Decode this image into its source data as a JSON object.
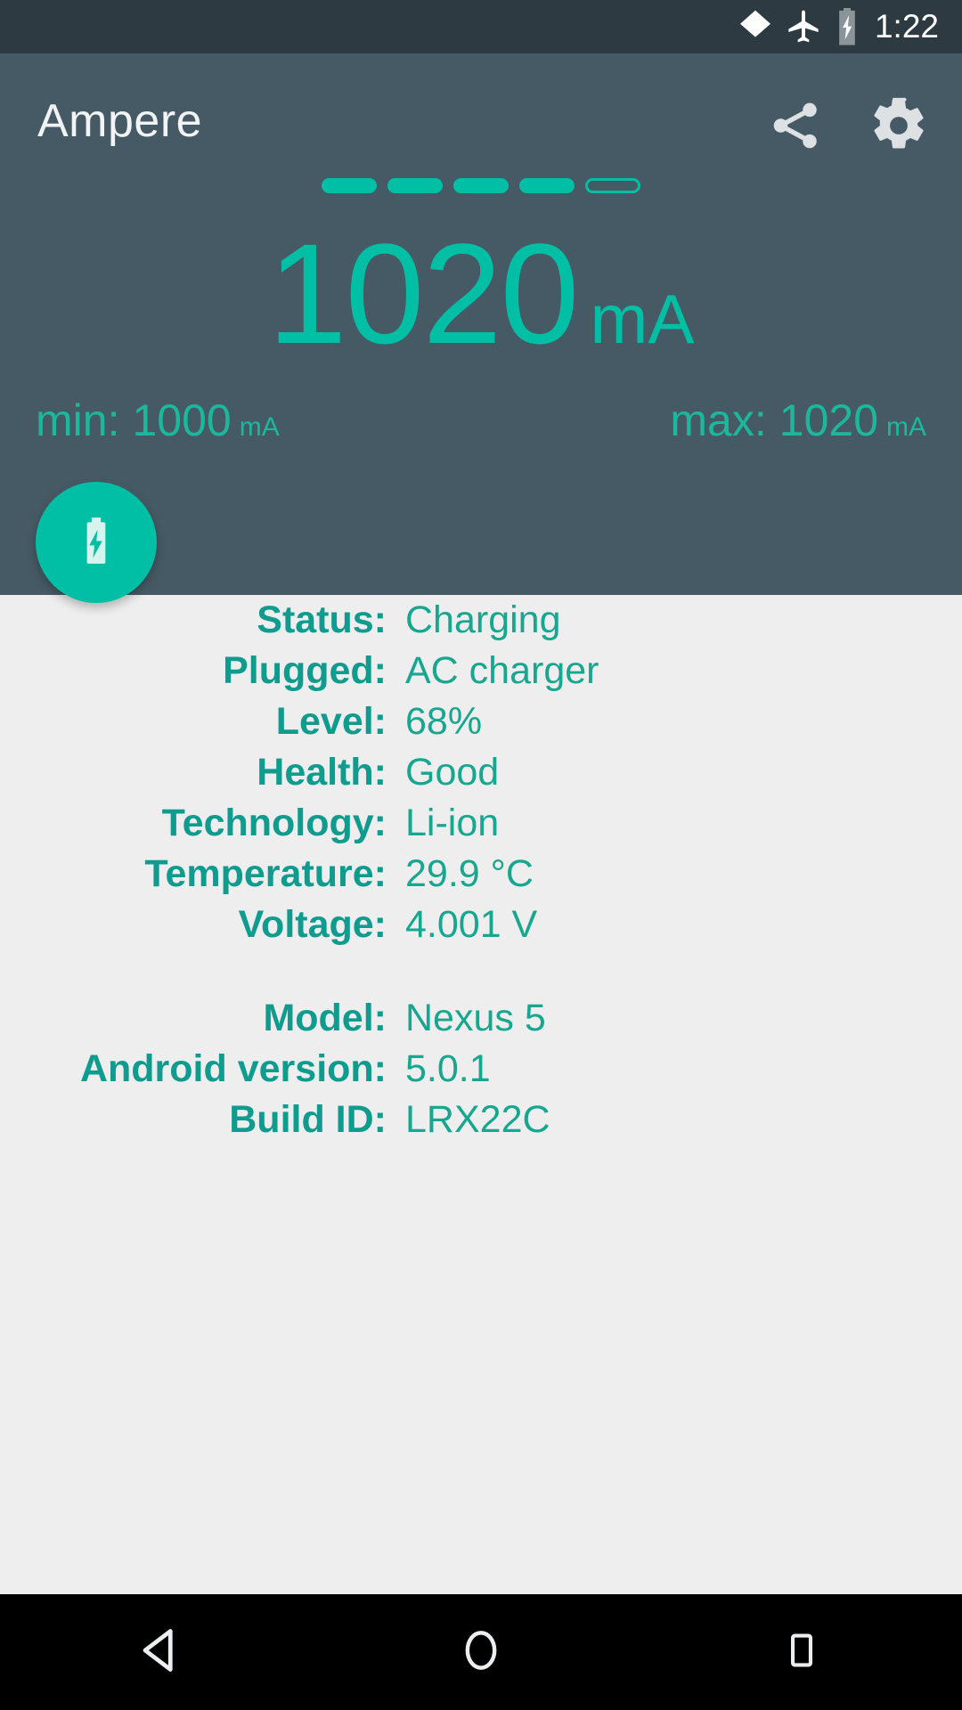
{
  "status_bar": {
    "time": "1:22",
    "icons": [
      {
        "name": "wifi-icon"
      },
      {
        "name": "airplane-mode-icon"
      },
      {
        "name": "battery-charging-icon"
      }
    ]
  },
  "header": {
    "title": "Ampere",
    "share_icon": "share-icon",
    "settings_icon": "gear-icon",
    "accent_color": "#00bfa5",
    "background_color": "#465a65",
    "level_dashes": {
      "total": 5,
      "filled": 4
    },
    "reading": {
      "value": "1020",
      "unit": "mA"
    },
    "min": {
      "label": "min:",
      "value": "1000",
      "unit": "mA"
    },
    "max": {
      "label": "max:",
      "value": "1020",
      "unit": "mA"
    },
    "fab_icon": "battery-charging-bolt-icon"
  },
  "info": {
    "battery_rows": [
      {
        "label": "Status:",
        "value": "Charging"
      },
      {
        "label": "Plugged:",
        "value": "AC charger"
      },
      {
        "label": "Level:",
        "value": "68%"
      },
      {
        "label": "Health:",
        "value": "Good"
      },
      {
        "label": "Technology:",
        "value": "Li-ion"
      },
      {
        "label": "Temperature:",
        "value": "29.9 °C"
      },
      {
        "label": "Voltage:",
        "value": "4.001 V"
      }
    ],
    "device_rows": [
      {
        "label": "Model:",
        "value": "Nexus 5"
      },
      {
        "label": "Android version:",
        "value": "5.0.1"
      },
      {
        "label": "Build ID:",
        "value": "LRX22C"
      }
    ],
    "label_color": "#0f9b8e",
    "value_color": "#17a68f",
    "background_color": "#eeeeee"
  },
  "nav_bar": {
    "buttons": [
      {
        "name": "back-button",
        "icon": "back-triangle-icon"
      },
      {
        "name": "home-button",
        "icon": "home-circle-icon"
      },
      {
        "name": "recents-button",
        "icon": "recents-square-icon"
      }
    ]
  }
}
